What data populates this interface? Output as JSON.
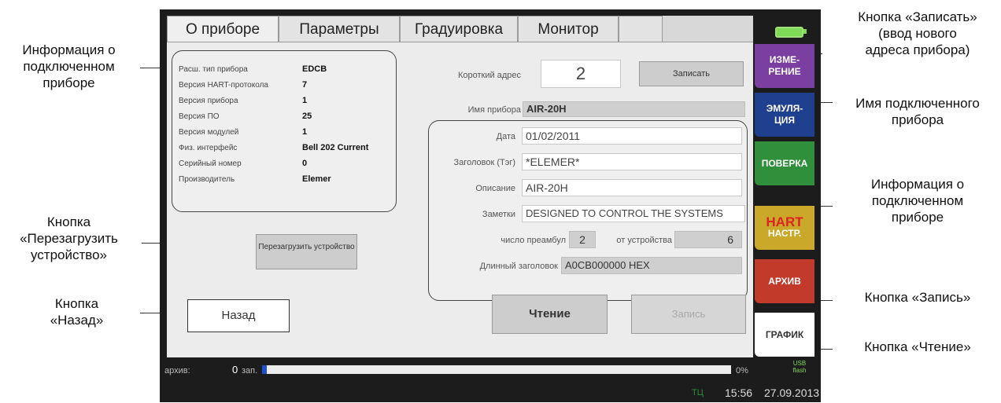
{
  "callouts": {
    "info_left": [
      "Информация о",
      "подключенном",
      "приборе"
    ],
    "reboot": [
      "Кнопка",
      "«Перезагрузить",
      "устройство»"
    ],
    "back": [
      "Кнопка",
      "«Назад»"
    ],
    "write_addr": [
      "Кнопка «Записать»",
      "(ввод нового",
      "адреса прибора)"
    ],
    "device_name": [
      "Имя подключенного",
      "прибора"
    ],
    "info_right": [
      "Информация о",
      "подключенном",
      "приборе"
    ],
    "write": "Кнопка «Запись»",
    "read": "Кнопка «Чтение»"
  },
  "tabs": [
    "О приборе",
    "Параметры",
    "Градуировка",
    "Монитор",
    ""
  ],
  "device_info": [
    {
      "label": "Расш. тип прибора",
      "value": "EDCB"
    },
    {
      "label": "Версия HART-протокола",
      "value": "7"
    },
    {
      "label": "Версия прибора",
      "value": "1"
    },
    {
      "label": "Версия ПО",
      "value": "25"
    },
    {
      "label": "Версия модулей",
      "value": "1"
    },
    {
      "label": "Физ. интерфейс",
      "value": "Bell 202 Current"
    },
    {
      "label": "Серийный номер",
      "value": "0"
    },
    {
      "label": "Производитель",
      "value": "Elemer"
    }
  ],
  "short_address": {
    "label": "Короткий адрес",
    "value": "2",
    "button": "Записать"
  },
  "device_name": {
    "label": "Имя прибора",
    "value": "AIR-20H"
  },
  "details": {
    "date_label": "Дата",
    "date": "01/02/2011",
    "tag_label": "Заголовок (Тэг)",
    "tag": "*ELEMER*",
    "desc_label": "Описание",
    "desc": "AIR-20H",
    "notes_label": "Заметки",
    "notes": "DESIGNED TO CONTROL THE SYSTEMS",
    "preamb_label": "число преамбул",
    "preamb": "2",
    "from_dev_label": "от устройства",
    "from_dev": "6",
    "long_tag_label": "Длинный заголовок",
    "long_tag": "A0CB000000 HEX"
  },
  "buttons": {
    "reboot": "Перезагрузить устройство",
    "back": "Назад",
    "read": "Чтение",
    "write": "Запись"
  },
  "side_menu": [
    {
      "label": "ИЗМЕ-РЕНИЕ",
      "color": "#7a3fa0"
    },
    {
      "label": "ЭМУЛЯ-ЦИЯ",
      "color": "#1f3f8f"
    },
    {
      "label": "ПОВЕРКА",
      "color": "#2f8f3a"
    },
    {
      "label": "HART",
      "label2": "НАСТР.",
      "color": "#c9a82a"
    },
    {
      "label": "АРХИВ",
      "color": "#c23a2a"
    },
    {
      "label": "ГРАФИК",
      "color": "#ffffff"
    }
  ],
  "status": {
    "archive_label": "архив:",
    "count": "0",
    "count_unit": "зап.",
    "progress": 0.01,
    "percent": "0%",
    "usb": "USB flash",
    "tc": "ТЦ",
    "time": "15:56",
    "date": "27.09.2013"
  }
}
